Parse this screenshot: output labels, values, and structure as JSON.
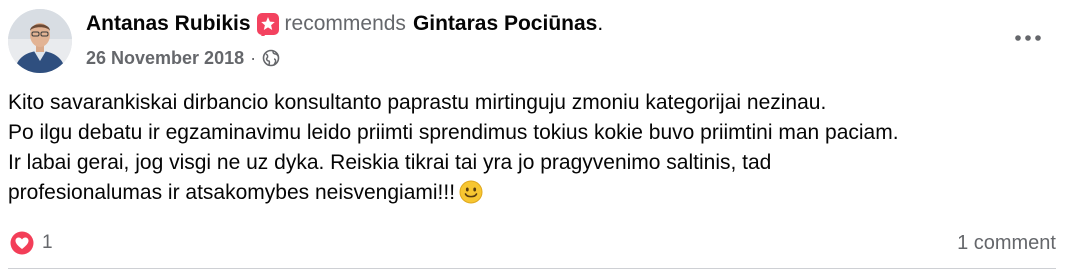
{
  "post": {
    "author": "Antanas Rubikis",
    "recommends_label": "recommends",
    "target": "Gintaras Pociūnas",
    "period": ".",
    "date": "26 November 2018",
    "meta_separator": "·",
    "audience_icon": "globe-icon",
    "badge_icon": "star-badge-icon",
    "more_icon": "more-options-icon",
    "text_lines": [
      "Kito savarankiskai dirbancio konsultanto paprastu mirtinguju zmoniu kategorijai nezinau.",
      "Po ilgu debatu ir egzaminavimu leido priimti sprendimus tokius kokie buvo priimtini man paciam.",
      "Ir labai gerai, jog visgi ne uz dyka. Reiskia tikrai tai yra jo pragyvenimo saltinis, tad",
      "profesionalumas ir atsakomybes neisvengiami!!!"
    ],
    "emoji_icon": "smiling-face-icon",
    "reaction_icon": "love-reaction-icon",
    "reaction_count": "1",
    "comments_label": "1 comment"
  },
  "colors": {
    "badge_pink": "#f3425f",
    "secondary_text": "#65676b",
    "primary_text": "#050505",
    "love_red": "#f33e58",
    "emoji_yellow": "#f7c631"
  }
}
